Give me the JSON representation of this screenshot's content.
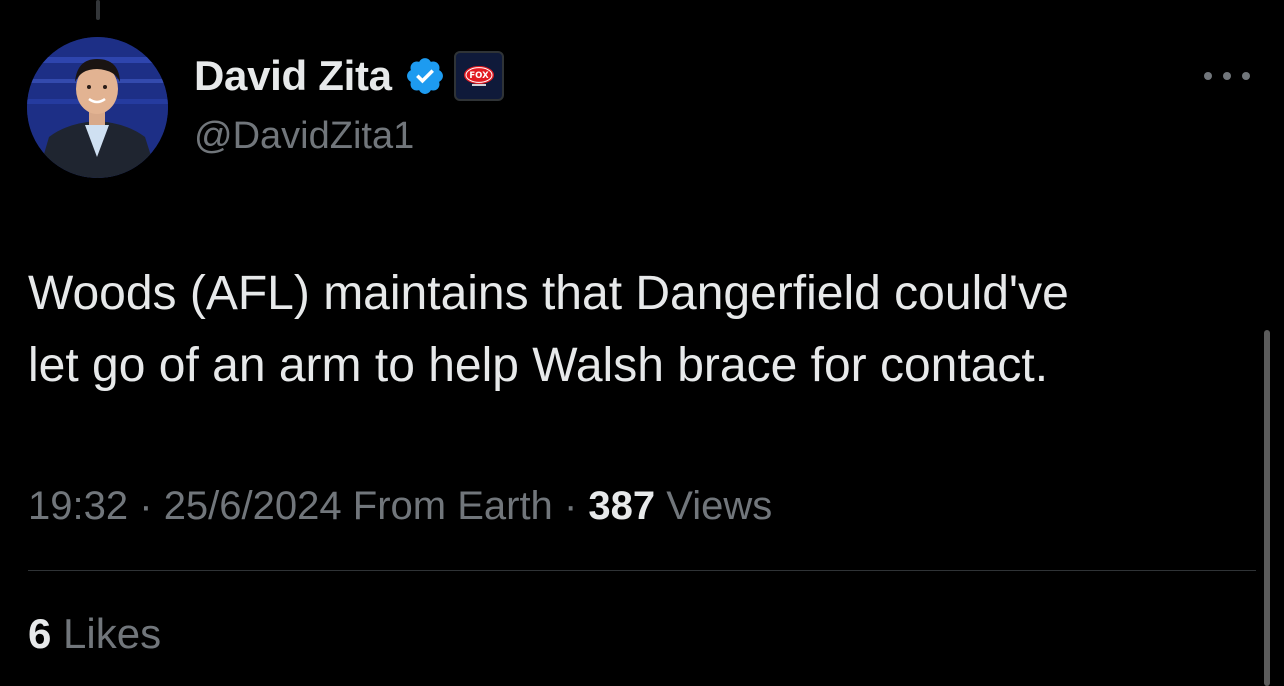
{
  "author": {
    "display_name": "David Zita",
    "handle": "@DavidZita1",
    "verified_icon": "verified-check-icon",
    "affiliate_badge": {
      "icon": "fox-sports-logo",
      "text": "FOX"
    }
  },
  "tweet": {
    "text": "Woods (AFL) maintains that Dangerfield could've\nlet go of an arm to help Walsh brace for contact.",
    "time": "19:32",
    "date": "25/6/2024",
    "source": "From Earth",
    "separator": "·",
    "views_count": "387",
    "views_label": "Views",
    "likes_count": "6",
    "likes_label": "Likes"
  },
  "colors": {
    "background": "#000000",
    "primary_text": "#e7e9ea",
    "secondary_text": "#71767b",
    "verified_blue": "#1d9bf0",
    "divider": "#2f3336"
  }
}
